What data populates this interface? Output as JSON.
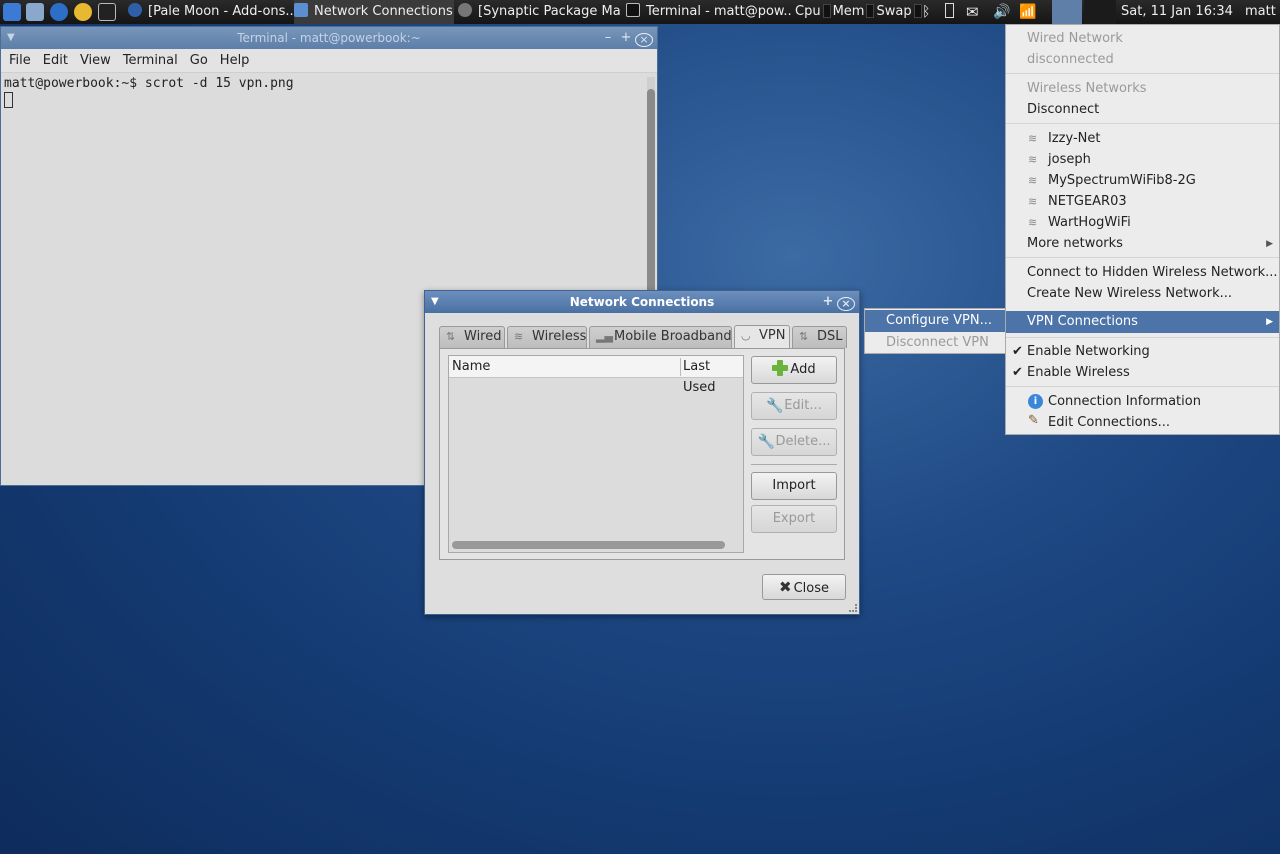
{
  "taskbar": {
    "tasks": [
      {
        "label": "[Pale Moon - Add-ons..."
      },
      {
        "label": "Network Connections"
      },
      {
        "label": "[Synaptic Package Ma..."
      },
      {
        "label": "Terminal - matt@pow..."
      }
    ],
    "monitors": {
      "cpu": "Cpu",
      "mem": "Mem",
      "swap": "Swap"
    },
    "clock": "Sat, 11 Jan  16:34",
    "user": "matt"
  },
  "terminal": {
    "title": "Terminal - matt@powerbook:~",
    "menu": [
      "File",
      "Edit",
      "View",
      "Terminal",
      "Go",
      "Help"
    ],
    "line": "matt@powerbook:~$ scrot -d 15 vpn.png"
  },
  "dialog": {
    "title": "Network Connections",
    "tabs": [
      "Wired",
      "Wireless",
      "Mobile Broadband",
      "VPN",
      "DSL"
    ],
    "active_tab": "VPN",
    "columns": [
      "Name",
      "Last Used"
    ],
    "buttons": {
      "add": "Add",
      "edit": "Edit...",
      "delete": "Delete...",
      "import": "Import",
      "export": "Export",
      "close": "Close"
    }
  },
  "network_menu": {
    "wired_header": "Wired Network",
    "wired_status": "disconnected",
    "wireless_header": "Wireless Networks",
    "disconnect": "Disconnect",
    "networks": [
      "Izzy-Net",
      "joseph",
      "MySpectrumWiFib8-2G",
      "NETGEAR03",
      "WartHogWiFi"
    ],
    "more_networks": "More networks",
    "connect_hidden": "Connect to Hidden Wireless Network...",
    "create_new": "Create New Wireless Network...",
    "vpn_connections": "VPN Connections",
    "enable_networking": "Enable Networking",
    "enable_wireless": "Enable Wireless",
    "connection_info": "Connection Information",
    "edit_connections": "Edit Connections..."
  },
  "vpn_submenu": {
    "configure": "Configure VPN...",
    "disconnect": "Disconnect VPN"
  }
}
